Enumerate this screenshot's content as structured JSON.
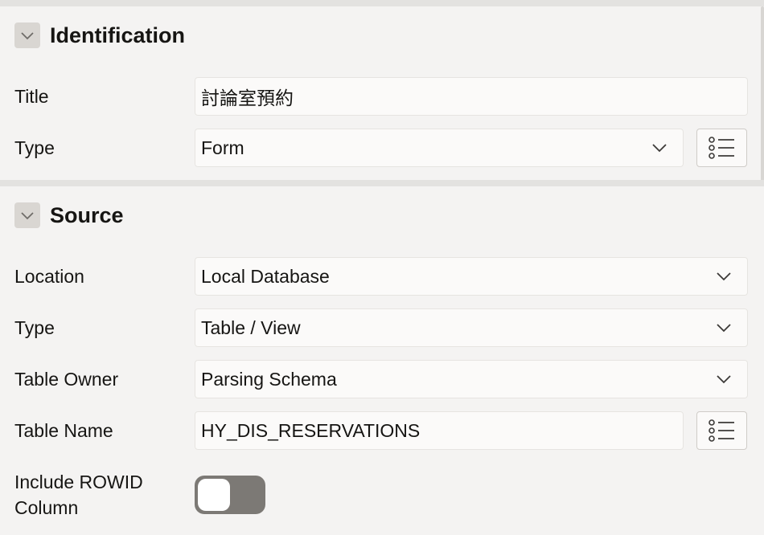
{
  "identification": {
    "title": "Identification",
    "title_label": "Title",
    "title_value": "討論室預約",
    "type_label": "Type",
    "type_value": "Form"
  },
  "source": {
    "title": "Source",
    "location_label": "Location",
    "location_value": "Local Database",
    "type_label": "Type",
    "type_value": "Table / View",
    "table_owner_label": "Table Owner",
    "table_owner_value": "Parsing Schema",
    "table_name_label": "Table Name",
    "table_name_value": "HY_DIS_RESERVATIONS",
    "include_rowid_label_line1": "Include ROWID",
    "include_rowid_label_line2": "Column",
    "include_rowid_on": false
  },
  "icons": [
    "chevron-down-icon",
    "list-icon"
  ]
}
